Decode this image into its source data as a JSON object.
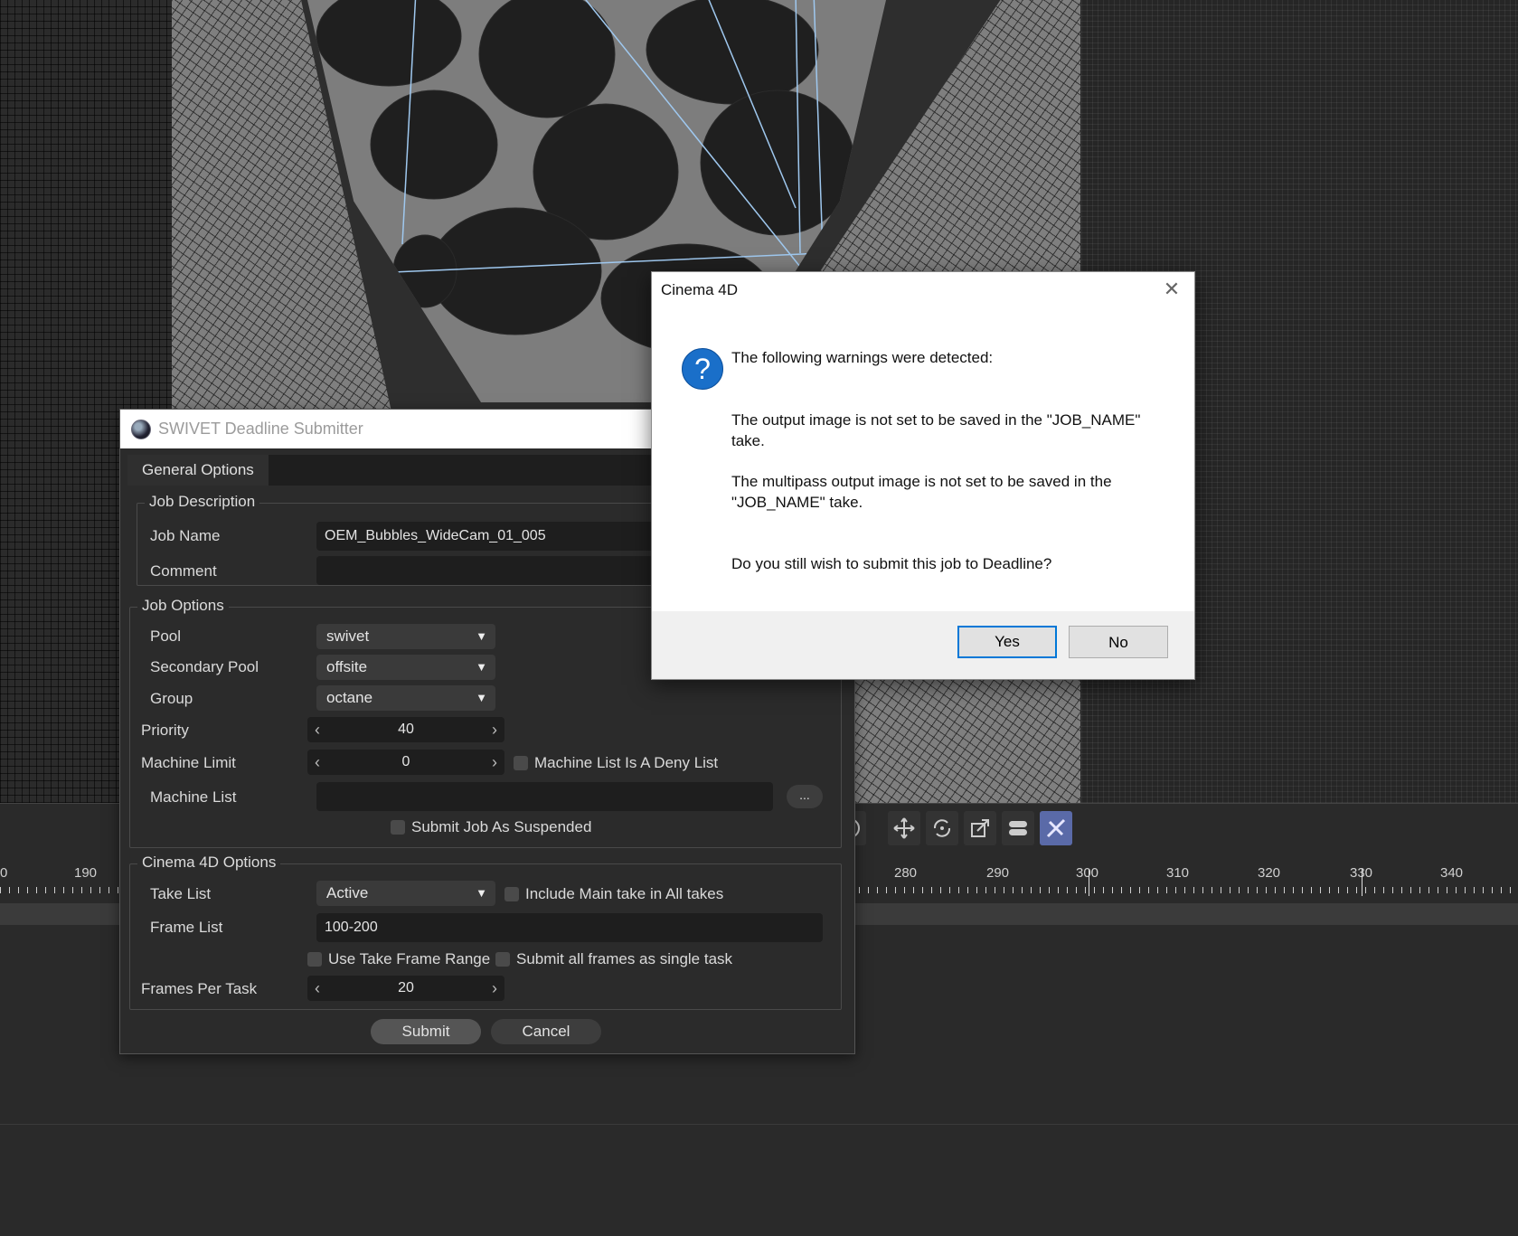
{
  "timeline": {
    "labels": [
      "0",
      "190",
      "280",
      "290",
      "300",
      "310",
      "320",
      "330",
      "340"
    ],
    "toolbar_icons": [
      "rotate-icon",
      "move-icon",
      "rotate-cycle-icon",
      "scale-icon",
      "toggle-icon",
      "snap-icon"
    ]
  },
  "submitter": {
    "title": "SWIVET Deadline Submitter",
    "tab": "General Options",
    "job_description": {
      "title": "Job Description",
      "job_name_label": "Job Name",
      "job_name_value": "OEM_Bubbles_WideCam_01_005",
      "comment_label": "Comment",
      "comment_value": ""
    },
    "job_options": {
      "title": "Job Options",
      "pool_label": "Pool",
      "pool_value": "swivet",
      "secondary_pool_label": "Secondary Pool",
      "secondary_pool_value": "offsite",
      "group_label": "Group",
      "group_value": "octane",
      "priority_label": "Priority",
      "priority_value": "40",
      "machine_limit_label": "Machine Limit",
      "machine_limit_value": "0",
      "deny_list_label": "Machine List Is A Deny List",
      "machine_list_label": "Machine List",
      "machine_list_value": "",
      "browse_label": "...",
      "suspended_label": "Submit Job As Suspended"
    },
    "c4d_options": {
      "title": "Cinema 4D Options",
      "take_list_label": "Take List",
      "take_list_value": "Active",
      "include_main_label": "Include Main take in All takes",
      "frame_list_label": "Frame List",
      "frame_list_value": "100-200",
      "use_take_range_label": "Use Take Frame Range",
      "single_task_label": "Submit all frames as single task",
      "frames_per_task_label": "Frames Per Task",
      "frames_per_task_value": "20"
    },
    "submit_label": "Submit",
    "cancel_label": "Cancel"
  },
  "msgbox": {
    "title": "Cinema 4D",
    "line1": "The following warnings were detected:",
    "line2a": "The output image is not set to be saved in the \"JOB_NAME\"",
    "line2b": "take.",
    "line3a": "The multipass output image is not set to be saved in the",
    "line3b": "\"JOB_NAME\" take.",
    "line4": "Do you still wish to submit this job to Deadline?",
    "yes_label": "Yes",
    "no_label": "No"
  },
  "colors": {
    "win_accent": "#0078d7",
    "question_icon": "#1a6fc9",
    "active_tool": "#5a6aa8"
  }
}
